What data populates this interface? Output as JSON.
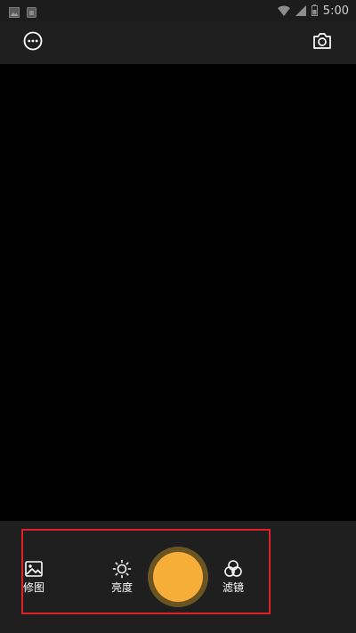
{
  "status_bar": {
    "time": "5:00",
    "icons": [
      "image-notification-icon",
      "sim-notification-icon",
      "wifi-icon",
      "signal-icon",
      "battery-icon"
    ]
  },
  "top_bar": {
    "icons": [
      "more-options-icon",
      "switch-camera-icon"
    ]
  },
  "bottom_controls": {
    "tools": [
      {
        "label": "修图",
        "icon": "image-edit-icon"
      },
      {
        "label": "亮度",
        "icon": "brightness-icon"
      },
      {
        "label": "滤镜",
        "icon": "filter-icon"
      }
    ],
    "shutter_icon": "shutter-button"
  },
  "colors": {
    "accent": "#f6ae39",
    "shutter_ring": "#6b5424",
    "highlight_box": "#e0202a",
    "bar_background": "#1f1f1f",
    "preview_background": "#000000"
  }
}
